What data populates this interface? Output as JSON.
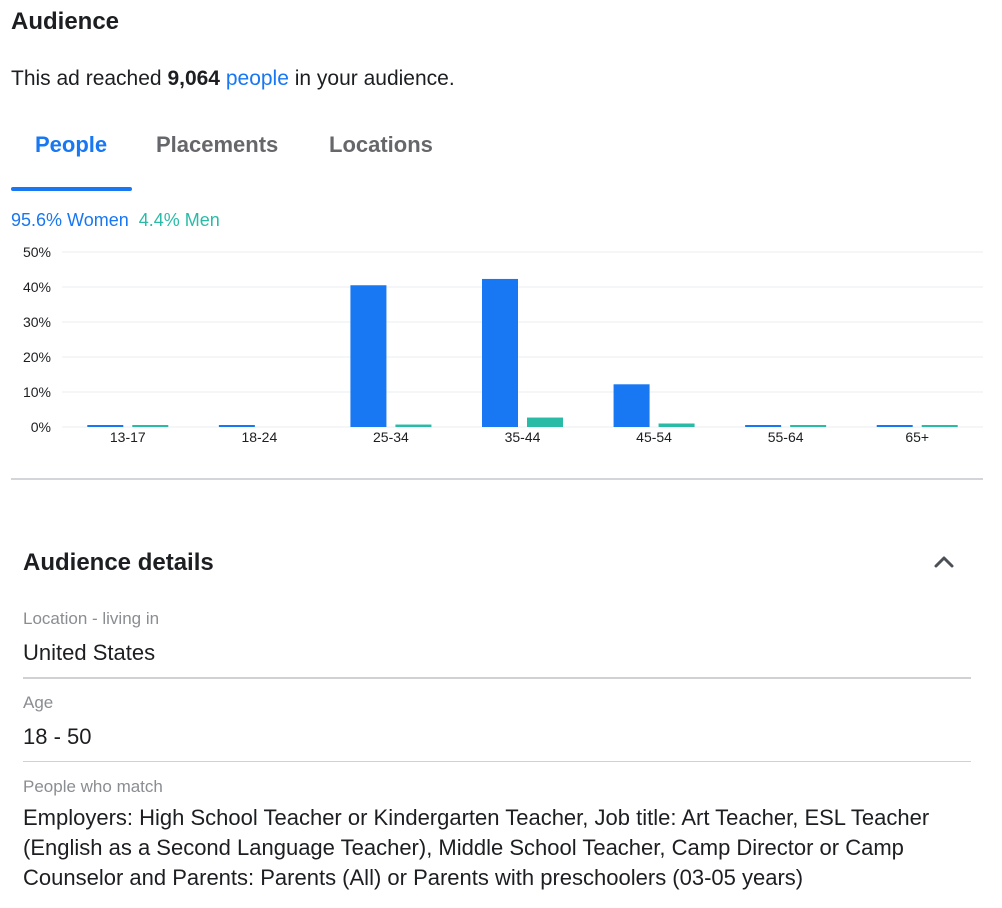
{
  "audience": {
    "title": "Audience",
    "reach_prefix": "This ad reached ",
    "reach_count": "9,064",
    "reach_link": "people",
    "reach_suffix": " in your audience."
  },
  "tabs": [
    {
      "label": "People",
      "active": true
    },
    {
      "label": "Placements",
      "active": false
    },
    {
      "label": "Locations",
      "active": false
    }
  ],
  "gender": {
    "women_label": "95.6% Women",
    "men_label": "4.4% Men"
  },
  "colors": {
    "women": "#1877f2",
    "men": "#2abba7",
    "accent": "#1877f2"
  },
  "chart_data": {
    "type": "bar",
    "categories": [
      "13-17",
      "18-24",
      "25-34",
      "35-44",
      "45-54",
      "55-64",
      "65+"
    ],
    "series": [
      {
        "name": "Women",
        "values": [
          0.2,
          0.5,
          40.5,
          42.3,
          12.2,
          0.2,
          0.2
        ]
      },
      {
        "name": "Men",
        "values": [
          0.2,
          0,
          0.7,
          2.7,
          1.0,
          0.2,
          0.2
        ]
      }
    ],
    "yticks": [
      "0%",
      "10%",
      "20%",
      "30%",
      "40%",
      "50%"
    ],
    "ylim": [
      0,
      50
    ],
    "grid": true,
    "legend": "top-left"
  },
  "audience_details": {
    "title": "Audience details",
    "fields": [
      {
        "label": "Location - living in",
        "value": "United States"
      },
      {
        "label": "Age",
        "value": "18 - 50"
      },
      {
        "label": "People who match",
        "value": "Employers: High School Teacher or Kindergarten Teacher, Job title: Art Teacher, ESL Teacher (English as a Second Language Teacher), Middle School Teacher, Camp Director or Camp Counselor and Parents: Parents (All) or Parents with preschoolers (03-05 years)"
      }
    ]
  }
}
